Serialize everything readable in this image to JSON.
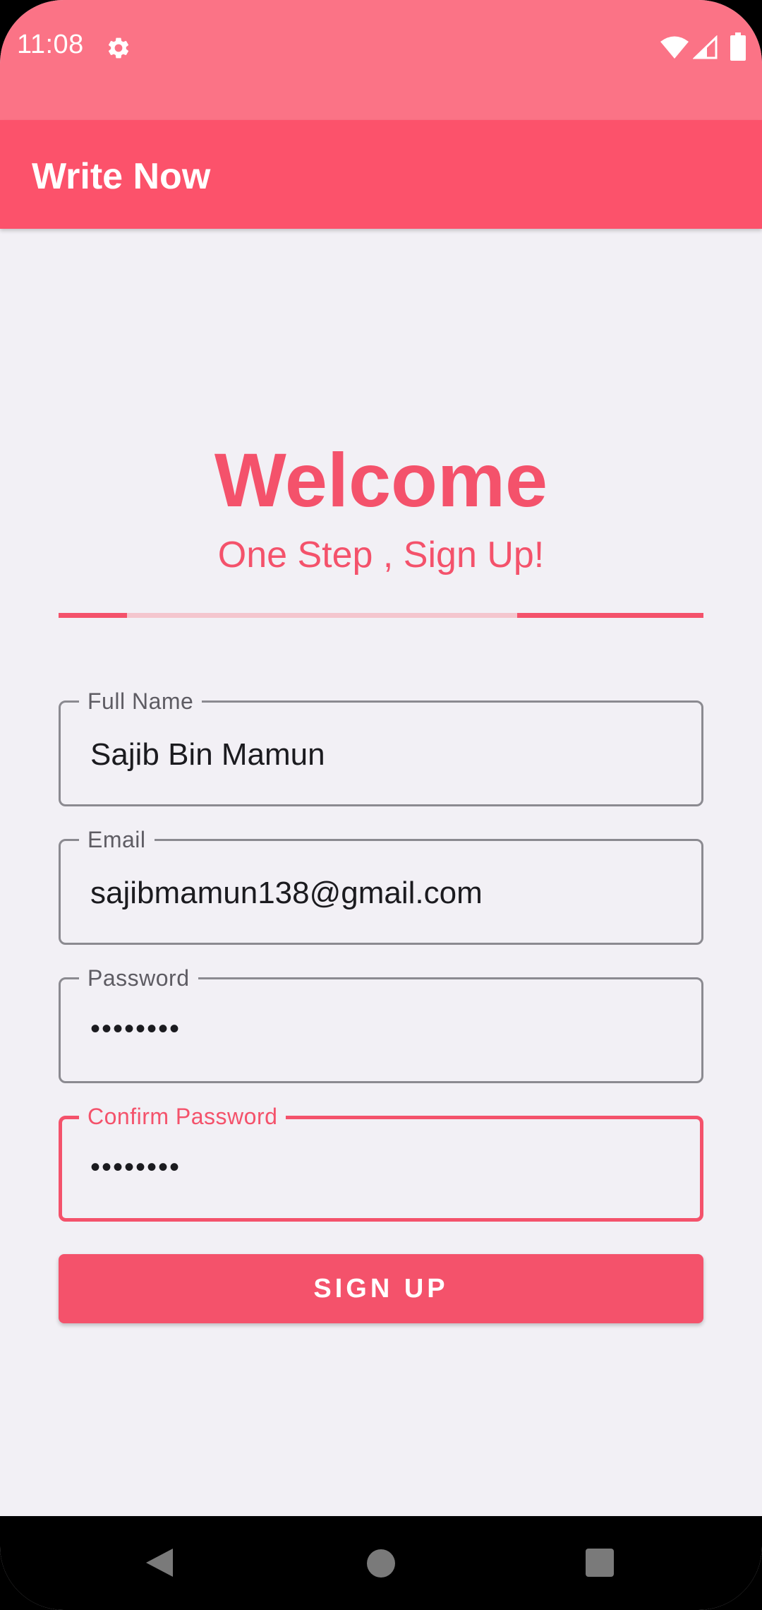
{
  "status_bar": {
    "time": "11:08",
    "icons": [
      "gear-icon",
      "wifi-icon",
      "signal-icon",
      "battery-icon"
    ]
  },
  "app_bar": {
    "title": "Write Now"
  },
  "header": {
    "title": "Welcome",
    "subtitle": "One Step , Sign Up!"
  },
  "form": {
    "full_name": {
      "label": "Full Name",
      "value": "Sajib Bin Mamun"
    },
    "email": {
      "label": "Email",
      "value": "sajibmamun138@gmail.com"
    },
    "password": {
      "label": "Password",
      "value": "••••••••"
    },
    "confirm_password": {
      "label": "Confirm Password",
      "value": "••••••••"
    }
  },
  "signup_button": {
    "label": "SIGN UP"
  },
  "colors": {
    "status_bar": "#FB7386",
    "app_bar": "#FC526B",
    "accent": "#F4526B",
    "background": "#F2F0F5"
  },
  "nav_bar": {
    "icons": [
      "back-icon",
      "home-icon",
      "recents-icon"
    ]
  }
}
